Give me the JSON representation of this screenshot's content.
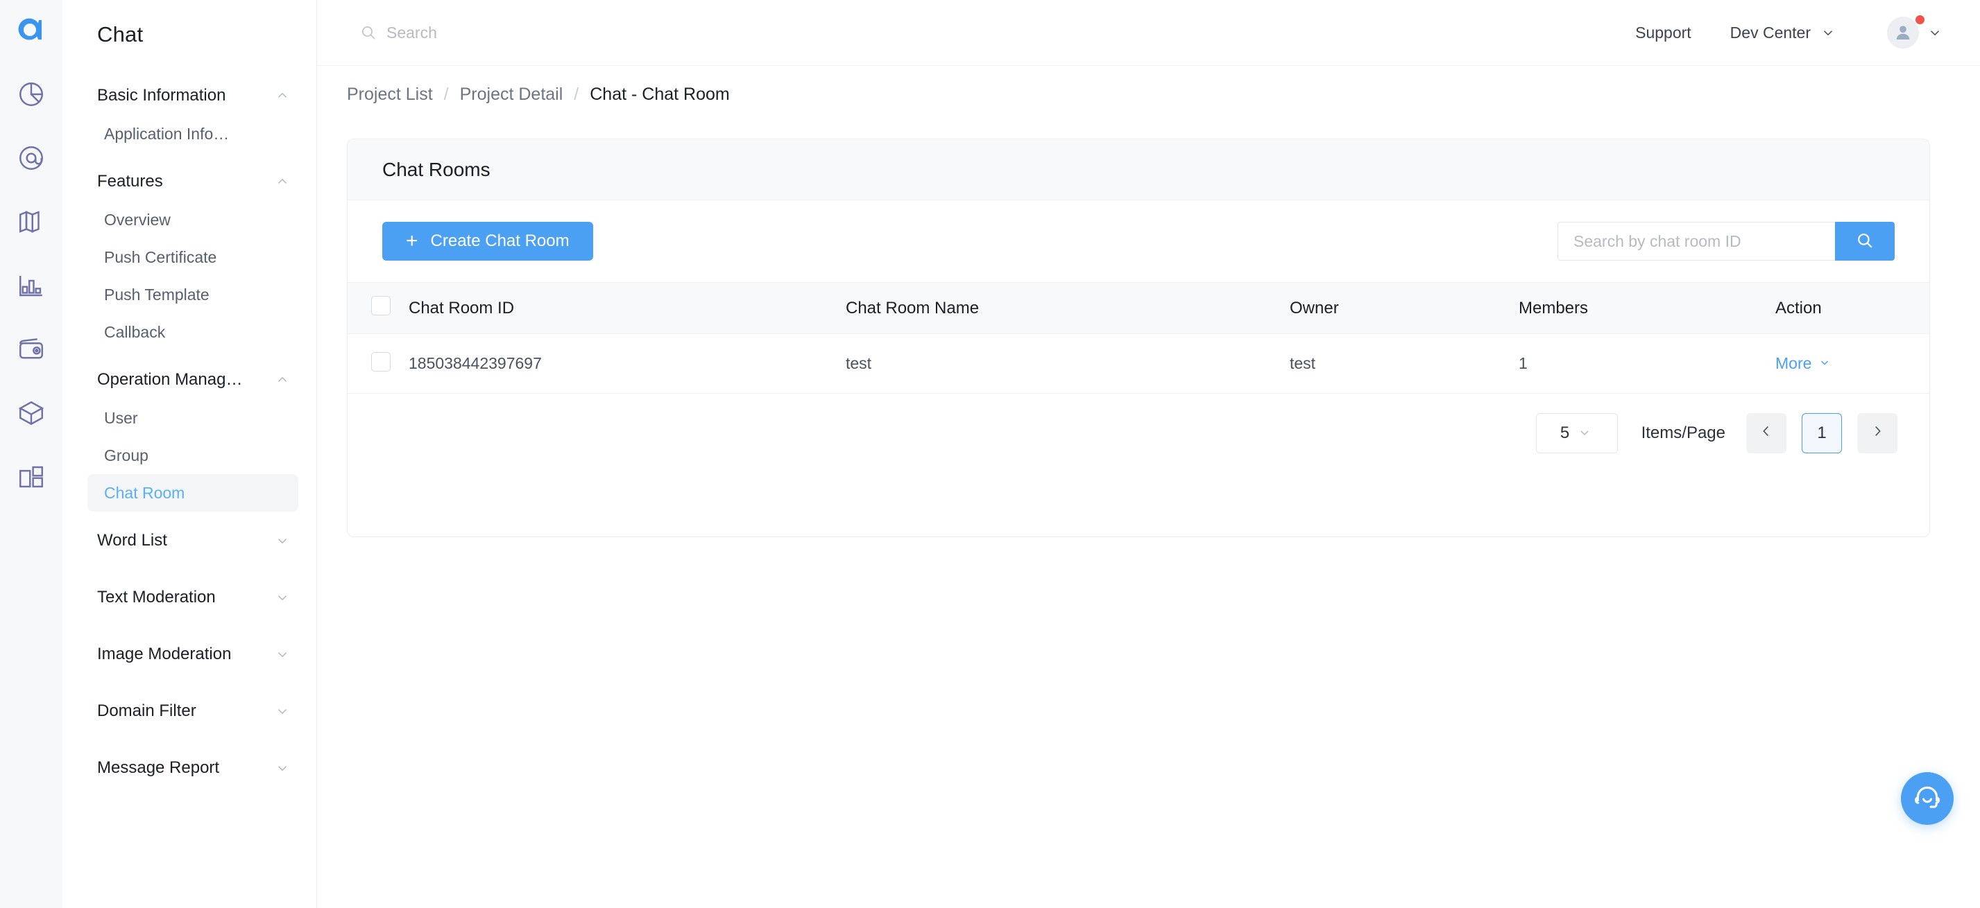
{
  "brand": {
    "logo_icon": "agora-logo-icon",
    "accent": "#4ba0f3"
  },
  "icon_rail": [
    {
      "icon": "pie-chart-icon"
    },
    {
      "icon": "at-mention-icon"
    },
    {
      "icon": "map-icon"
    },
    {
      "icon": "bar-chart-icon"
    },
    {
      "icon": "wallet-icon"
    },
    {
      "icon": "package-box-icon"
    },
    {
      "icon": "layout-grid-icon"
    }
  ],
  "sidebar": {
    "title": "Chat",
    "groups": [
      {
        "label": "Basic Information",
        "expanded": true,
        "chevron": "chevron-up-icon",
        "items": [
          {
            "label": "Application Info…",
            "active": false
          }
        ]
      },
      {
        "label": "Features",
        "expanded": true,
        "chevron": "chevron-up-icon",
        "items": [
          {
            "label": "Overview",
            "active": false
          },
          {
            "label": "Push Certificate",
            "active": false
          },
          {
            "label": "Push Template",
            "active": false
          },
          {
            "label": "Callback",
            "active": false
          }
        ]
      },
      {
        "label": "Operation Manag…",
        "expanded": true,
        "chevron": "chevron-up-icon",
        "items": [
          {
            "label": "User",
            "active": false
          },
          {
            "label": "Group",
            "active": false
          },
          {
            "label": "Chat Room",
            "active": true
          }
        ]
      },
      {
        "label": "Word List",
        "expanded": false,
        "chevron": "chevron-down-icon",
        "items": []
      },
      {
        "label": "Text Moderation",
        "expanded": false,
        "chevron": "chevron-down-icon",
        "items": []
      },
      {
        "label": "Image Moderation",
        "expanded": false,
        "chevron": "chevron-down-icon",
        "items": []
      },
      {
        "label": "Domain Filter",
        "expanded": false,
        "chevron": "chevron-down-icon",
        "items": []
      },
      {
        "label": "Message Report",
        "expanded": false,
        "chevron": "chevron-down-icon",
        "items": []
      }
    ]
  },
  "topbar": {
    "search_placeholder": "Search",
    "search_value": "",
    "search_icon": "search-icon",
    "support_label": "Support",
    "dev_center_label": "Dev Center",
    "dev_center_chevron": "chevron-down-icon",
    "avatar_icon": "user-avatar-icon",
    "notification_dot": true,
    "account_chevron": "chevron-down-icon"
  },
  "breadcrumb": {
    "items": [
      {
        "label": "Project List",
        "current": false
      },
      {
        "label": "Project Detail",
        "current": false
      },
      {
        "label": "Chat - Chat Room",
        "current": true
      }
    ],
    "separator": "/"
  },
  "card": {
    "title": "Chat Rooms",
    "toolbar": {
      "create_label": "Create Chat Room",
      "create_icon": "plus-icon",
      "search_placeholder": "Search by chat room ID",
      "search_value": "",
      "search_button_icon": "search-icon"
    },
    "table": {
      "select_all_checked": false,
      "columns": [
        {
          "key": "id",
          "label": "Chat Room ID"
        },
        {
          "key": "name",
          "label": "Chat Room Name"
        },
        {
          "key": "owner",
          "label": "Owner"
        },
        {
          "key": "members",
          "label": "Members"
        },
        {
          "key": "action",
          "label": "Action"
        }
      ],
      "rows": [
        {
          "checked": false,
          "id": "185038442397697",
          "name": "test",
          "owner": "test",
          "members": "1",
          "action_label": "More",
          "action_chevron": "chevron-down-icon"
        }
      ]
    },
    "pagination": {
      "page_size": "5",
      "page_size_chevron": "chevron-down-icon",
      "items_per_page_label": "Items/Page",
      "prev_icon": "chevron-left-icon",
      "next_icon": "chevron-right-icon",
      "current_page": "1"
    }
  },
  "fab": {
    "icon": "headset-support-icon"
  }
}
